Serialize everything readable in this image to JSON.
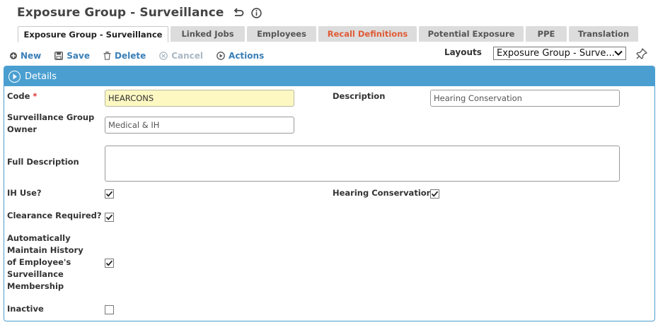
{
  "header": {
    "title": "Exposure Group - Surveillance"
  },
  "tabs": [
    {
      "label": "Exposure Group - Surveillance",
      "active": true
    },
    {
      "label": "Linked Jobs"
    },
    {
      "label": "Employees"
    },
    {
      "label": "Recall Definitions",
      "alert_color": "#e05a35"
    },
    {
      "label": "Potential Exposure"
    },
    {
      "label": "PPE"
    },
    {
      "label": "Translation"
    }
  ],
  "toolbar": {
    "new_label": "New",
    "save_label": "Save",
    "delete_label": "Delete",
    "cancel_label": "Cancel",
    "actions_label": "Actions"
  },
  "layouts": {
    "label": "Layouts",
    "selected": "Exposure Group - Surve..."
  },
  "panel": {
    "title": "Details",
    "accent": "#4a9fd0"
  },
  "form": {
    "code_label": "Code",
    "code_required_mark": "*",
    "code_value": "HEARCONS",
    "description_label": "Description",
    "description_value": "Hearing Conservation",
    "owner_label": "Surveillance Group Owner",
    "owner_value": "Medical & IH",
    "full_description_label": "Full Description",
    "full_description_value": "",
    "ih_use_label": "IH Use?",
    "ih_use_checked": true,
    "hearing_conservation_label": "Hearing Conservation",
    "hearing_conservation_checked": true,
    "clearance_label": "Clearance Required?",
    "clearance_checked": true,
    "auto_maintain_label": "Automatically Maintain History of Employee's Surveillance Membership",
    "auto_maintain_checked": true,
    "inactive_label": "Inactive",
    "inactive_checked": false
  }
}
